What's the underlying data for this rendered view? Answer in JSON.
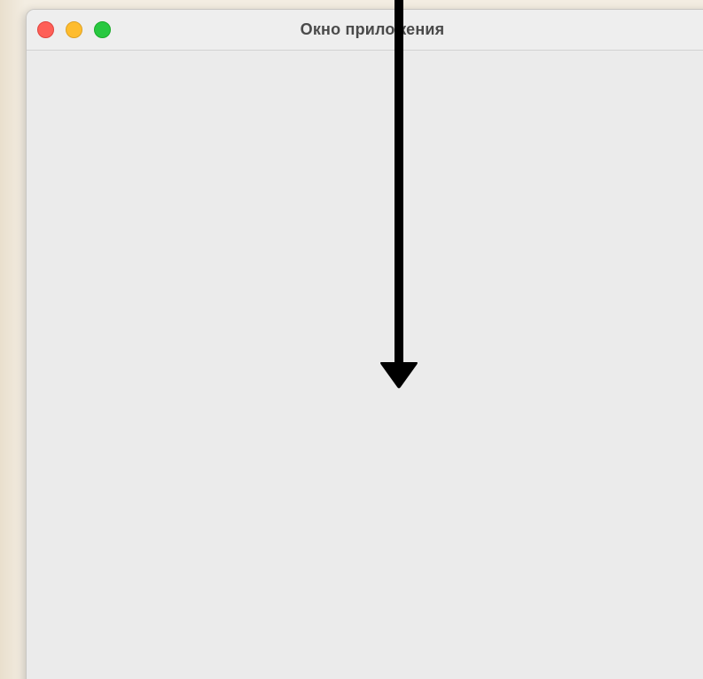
{
  "desktop": {
    "background_color": "#efe8da"
  },
  "window": {
    "title": "Окно приложения",
    "controls": {
      "close": {
        "color": "#fe5f57",
        "icon": "close-icon"
      },
      "minimize": {
        "color": "#febc2e",
        "icon": "minimize-icon"
      },
      "zoom": {
        "color": "#28c840",
        "icon": "zoom-icon"
      }
    },
    "content_background": "#ebebeb"
  },
  "overlay": {
    "arrow": {
      "direction": "down",
      "color": "#000000",
      "icon": "down-arrow-icon"
    }
  }
}
